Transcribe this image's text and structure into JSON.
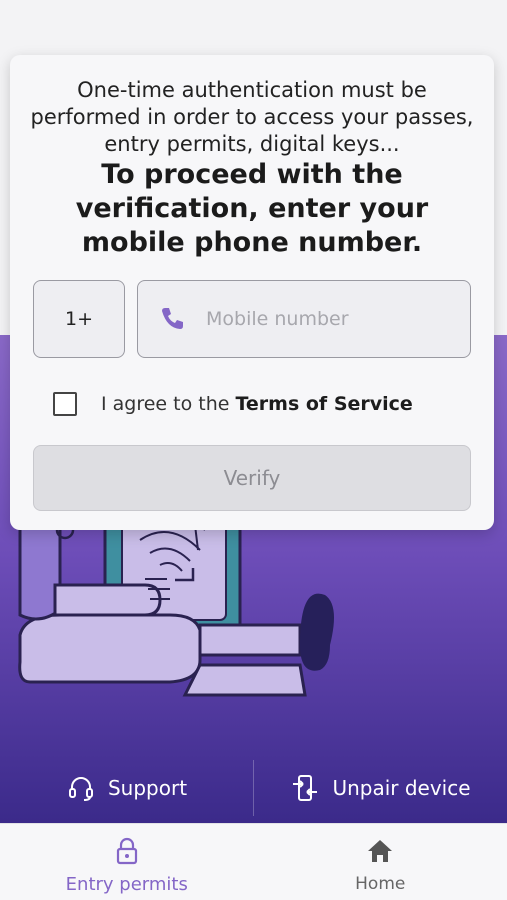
{
  "card": {
    "intro_text": "One-time authentication must be performed in order to access your passes, entry permits, digital keys...",
    "headline": "To proceed with the verification, enter your mobile phone number.",
    "country_code": "1+",
    "phone_placeholder": "Mobile number",
    "phone_icon": "phone-icon",
    "agree_prefix": "I agree to the",
    "agree_link": "Terms of Service",
    "verify_label": "Verify"
  },
  "hero_actions": {
    "support_label": "Support",
    "support_icon": "headset-icon",
    "unpair_label": "Unpair device",
    "unpair_icon": "unpair-device-icon"
  },
  "tabbar": {
    "tabs": [
      {
        "label": "Entry permits",
        "icon": "lock-icon",
        "active": true
      },
      {
        "label": "Home",
        "icon": "home-icon",
        "active": false
      }
    ]
  },
  "colors": {
    "accent": "#8466c7",
    "hero_top": "#8a69c8",
    "hero_bottom": "#3b2a8a"
  }
}
